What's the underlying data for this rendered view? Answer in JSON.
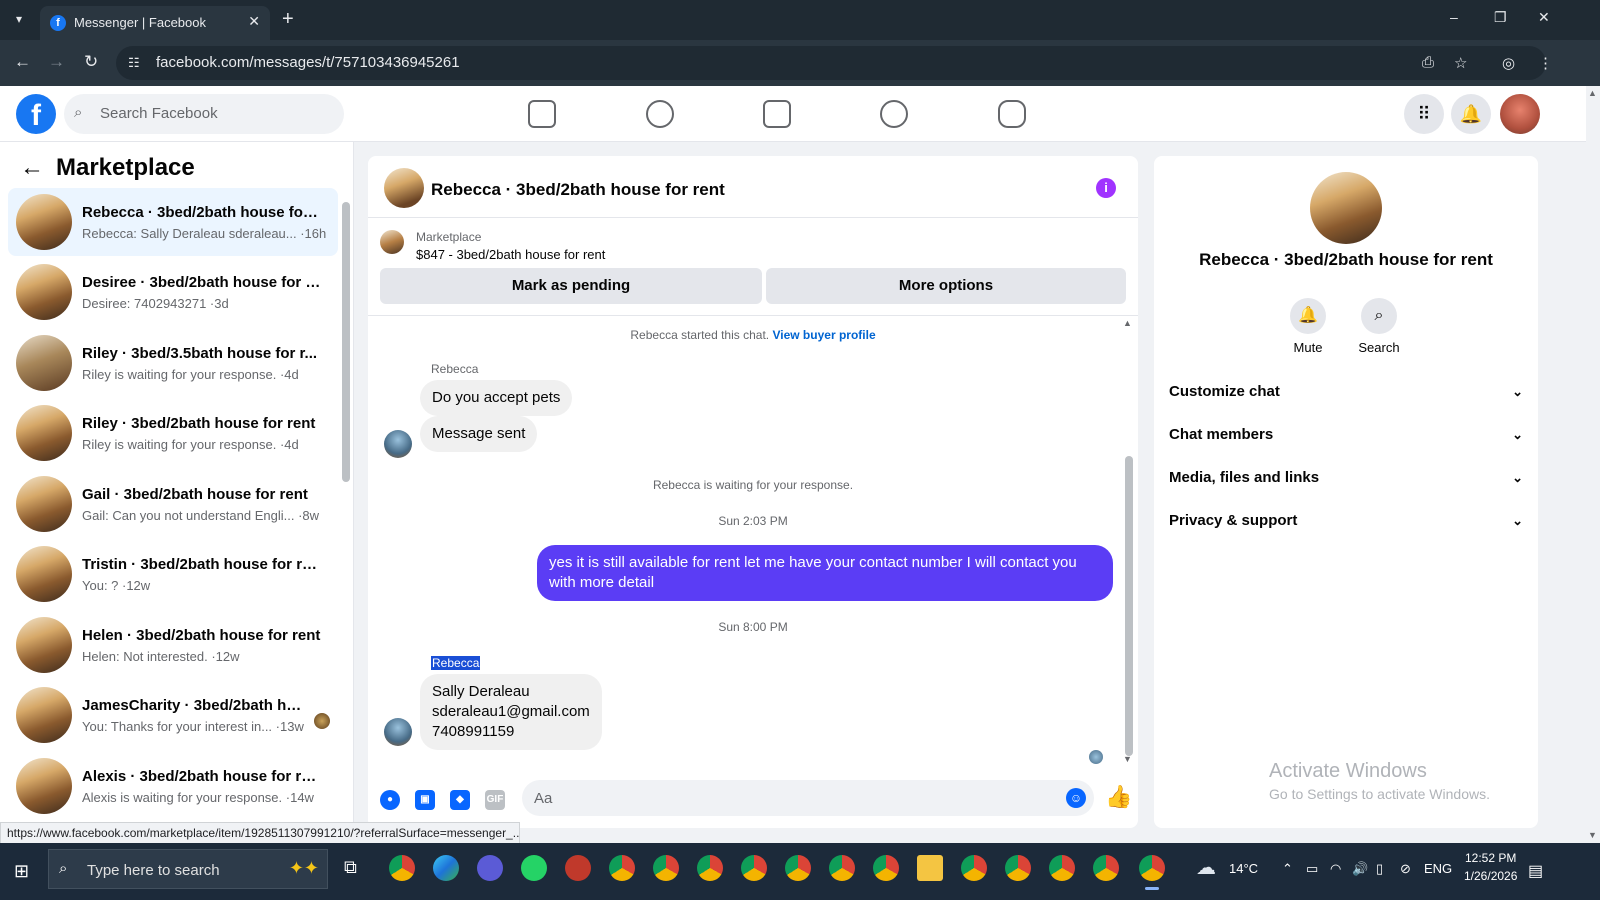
{
  "browser": {
    "tab_title": "Messenger | Facebook",
    "url": "facebook.com/messages/t/757103436945261",
    "window_controls": [
      "–",
      "❐",
      "✕"
    ],
    "status_url": "https://www.facebook.com/marketplace/item/1928511307991210/?referralSurface=messenger_..."
  },
  "header": {
    "search_placeholder": "Search Facebook",
    "nav_icons": [
      "home-icon",
      "friends-icon",
      "marketplace-icon",
      "groups-icon",
      "gaming-icon"
    ],
    "right_icons": [
      "menu-grid-icon",
      "notifications-icon",
      "account-avatar"
    ]
  },
  "sidebar": {
    "title": "Marketplace",
    "conversations": [
      {
        "name": "Rebecca · 3bed/2bath house for ...",
        "preview": "Rebecca: Sally Deraleau sderaleau... ·16h",
        "active": true
      },
      {
        "name": "Desiree · 3bed/2bath house for r...",
        "preview": "Desiree: 7402943271 ·3d"
      },
      {
        "name": "Riley · 3bed/3.5bath house for r...",
        "preview": "Riley is waiting for your response. ·4d"
      },
      {
        "name": "Riley · 3bed/2bath house for rent",
        "preview": "Riley is waiting for your response. ·4d"
      },
      {
        "name": "Gail · 3bed/2bath house for rent",
        "preview": "Gail: Can you not understand Engli... ·8w"
      },
      {
        "name": "Tristin · 3bed/2bath house for re...",
        "preview": "You: ? ·12w"
      },
      {
        "name": "Helen · 3bed/2bath house for rent",
        "preview": "Helen: Not interested. ·12w"
      },
      {
        "name": "JamesCharity · 3bed/2bath ho...",
        "preview": "You: Thanks for your interest in... ·13w"
      },
      {
        "name": "Alexis · 3bed/2bath house for rent",
        "preview": "Alexis is waiting for your response. ·14w"
      }
    ]
  },
  "chat": {
    "title": "Rebecca · 3bed/2bath house for rent",
    "info_icon": "i",
    "marketplace_label": "Marketplace",
    "listing": "$847 - 3bed/2bath house for rent",
    "mark_pending": "Mark as pending",
    "more_options": "More options",
    "started_text": "Rebecca started this chat.",
    "view_profile": "View buyer profile",
    "sender1": "Rebecca",
    "msg1": "Do you accept pets",
    "msg2": "Message sent",
    "waiting": "Rebecca is waiting for your response.",
    "time1": "Sun 2:03 PM",
    "out_msg": "yes it is still available for rent let me have your contact number I will contact you with more detail",
    "time2": "Sun 8:00 PM",
    "sender2": "Rebecca",
    "msg3_line1": "Sally Deraleau",
    "msg3_line2": "sderaleau1@gmail.com",
    "msg3_line3": "7408991159",
    "composer_placeholder": "Aa"
  },
  "details": {
    "name": "Rebecca · 3bed/2bath house for rent",
    "mute": "Mute",
    "search": "Search",
    "items": [
      "Customize chat",
      "Chat members",
      "Media, files and links",
      "Privacy & support"
    ]
  },
  "watermark": {
    "line1": "Activate Windows",
    "line2": "Go to Settings to activate Windows."
  },
  "taskbar": {
    "search_placeholder": "Type here to search",
    "weather": "14°C",
    "lang": "ENG",
    "time": "12:52 PM",
    "date": "1/26/2026"
  }
}
